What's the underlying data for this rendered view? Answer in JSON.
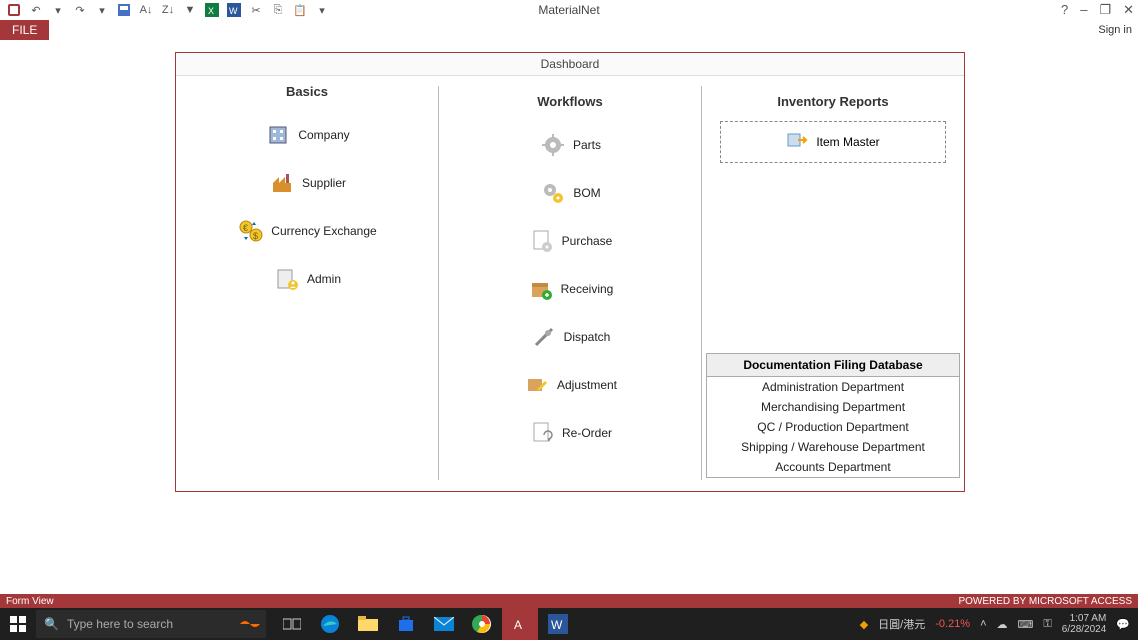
{
  "titlebar": {
    "app_title": "MaterialNet",
    "help": "?",
    "minimize": "–",
    "restore": "❐",
    "close": "✕"
  },
  "ribbon": {
    "file_label": "FILE",
    "signin_label": "Sign in"
  },
  "dashboard": {
    "title": "Dashboard",
    "col_basics": "Basics",
    "col_workflows": "Workflows",
    "col_reports": "Inventory Reports",
    "basics": {
      "company": "Company",
      "supplier": "Supplier",
      "currency": "Currency Exchange",
      "admin": "Admin"
    },
    "workflows": {
      "parts": "Parts",
      "bom": "BOM",
      "purchase": "Purchase",
      "receiving": "Receiving",
      "dispatch": "Dispatch",
      "adjustment": "Adjustment",
      "reorder": "Re-Order"
    },
    "reports": {
      "item_master": "Item Master"
    },
    "filing": {
      "header": "Documentation Filing Database",
      "items": [
        "Administration Department",
        "Merchandising Department",
        "QC / Production Department",
        "Shipping / Warehouse Department",
        "Accounts Department"
      ]
    }
  },
  "statusbar": {
    "left": "Form View",
    "right": "POWERED BY MICROSOFT ACCESS"
  },
  "taskbar": {
    "search_placeholder": "Type here to search",
    "tray_text": "日圓/港元",
    "tray_change": "-0.21%",
    "clock_time": "1:07 AM",
    "clock_date": "6/28/2024"
  }
}
